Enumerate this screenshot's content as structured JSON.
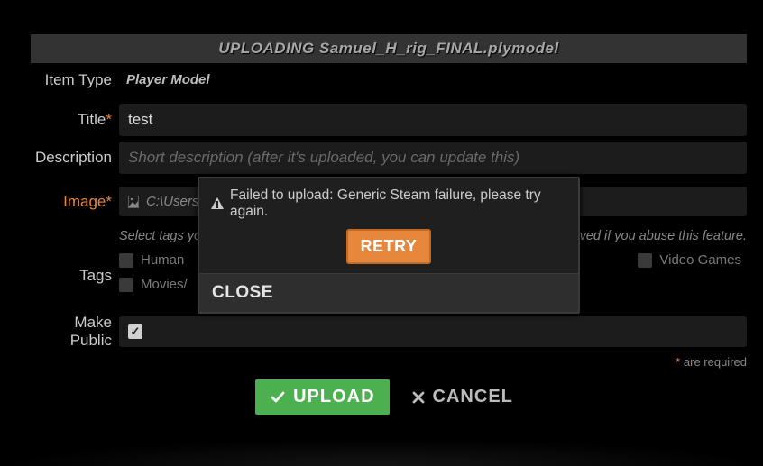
{
  "banner": {
    "prefix": "UPLOADING",
    "filename": "Samuel_H_rig_FINAL.plymodel"
  },
  "form": {
    "item_type_label": "Item Type",
    "item_type_value": "Player Model",
    "title_label": "Title",
    "title_value": "test",
    "description_label": "Description",
    "description_placeholder": "Short description (after it's uploaded, you can update this)",
    "image_label": "Image",
    "image_path": "C:\\Users",
    "tags_label": "Tags",
    "tags_hint_left": "Select tags yo",
    "tags_hint_right": "ved if you abuse this feature.",
    "tags": {
      "row1": [
        {
          "label": "Human",
          "checked": false
        },
        {
          "label": "Video Games",
          "checked": false
        }
      ],
      "row2": [
        {
          "label": "Movies/",
          "checked": false
        }
      ]
    },
    "public_label": "Make Public",
    "public_checked": true,
    "required_note": "are required",
    "required_star": "*"
  },
  "actions": {
    "upload": "UPLOAD",
    "cancel": "CANCEL"
  },
  "modal": {
    "message": "Failed to upload: Generic Steam failure, please try again.",
    "retry": "RETRY",
    "close": "CLOSE"
  }
}
